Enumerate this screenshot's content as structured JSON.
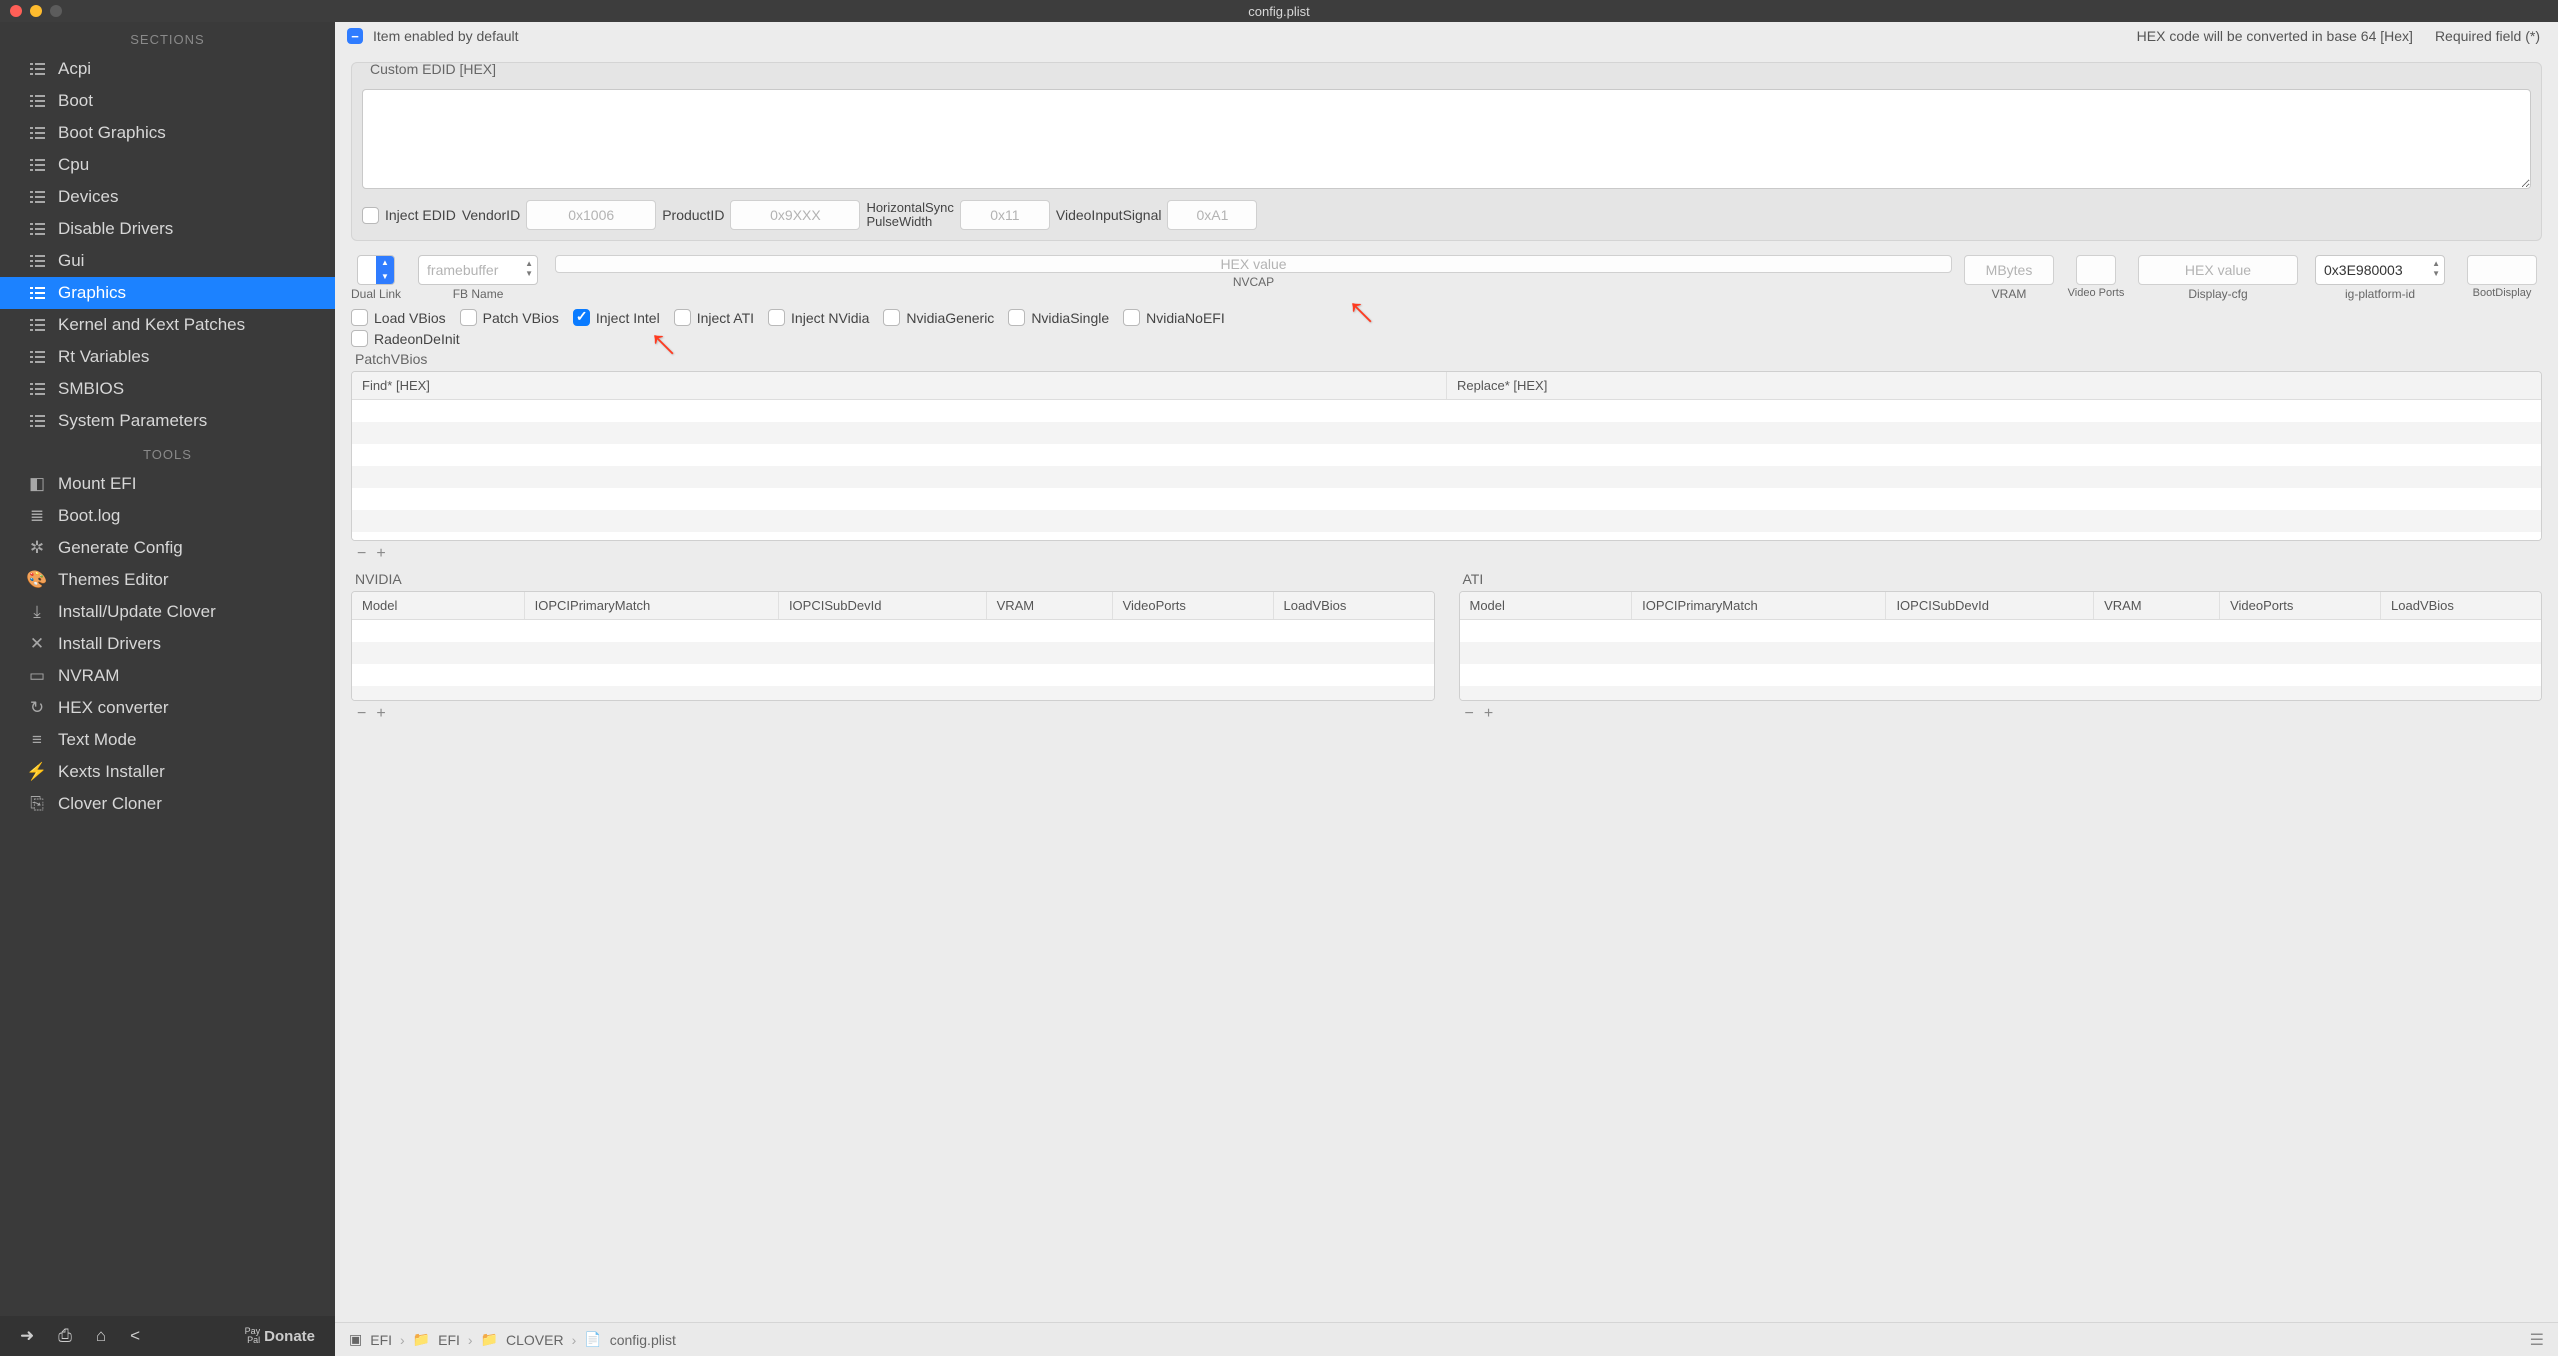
{
  "window": {
    "title": "config.plist"
  },
  "sidebar": {
    "sections_header": "SECTIONS",
    "tools_header": "TOOLS",
    "sections": [
      {
        "label": "Acpi"
      },
      {
        "label": "Boot"
      },
      {
        "label": "Boot Graphics"
      },
      {
        "label": "Cpu"
      },
      {
        "label": "Devices"
      },
      {
        "label": "Disable Drivers"
      },
      {
        "label": "Gui"
      },
      {
        "label": "Graphics"
      },
      {
        "label": "Kernel and Kext Patches"
      },
      {
        "label": "Rt Variables"
      },
      {
        "label": "SMBIOS"
      },
      {
        "label": "System Parameters"
      }
    ],
    "tools": [
      {
        "label": "Mount EFI",
        "glyph": "◧"
      },
      {
        "label": "Boot.log",
        "glyph": "≣"
      },
      {
        "label": "Generate Config",
        "glyph": "✲"
      },
      {
        "label": "Themes Editor",
        "glyph": "🎨"
      },
      {
        "label": "Install/Update Clover",
        "glyph": "⤓"
      },
      {
        "label": "Install Drivers",
        "glyph": "✕"
      },
      {
        "label": "NVRAM",
        "glyph": "▭"
      },
      {
        "label": "HEX converter",
        "glyph": "↻"
      },
      {
        "label": "Text Mode",
        "glyph": "≡"
      },
      {
        "label": "Kexts Installer",
        "glyph": "⚡"
      },
      {
        "label": "Clover Cloner",
        "glyph": "⎘"
      }
    ],
    "donate": "Donate"
  },
  "topbar": {
    "item_enabled": "Item enabled by default",
    "hex_note": "HEX code will be converted in base 64 [Hex]",
    "required": "Required field (*)"
  },
  "edid_group": {
    "legend": "Custom EDID [HEX]",
    "inject_edid": "Inject EDID",
    "vendor_lbl": "VendorID",
    "vendor_ph": "0x1006",
    "product_lbl": "ProductID",
    "product_ph": "0x9XXX",
    "hsync_lbl_a": "HorizontalSync",
    "hsync_lbl_b": "PulseWidth",
    "hsync_ph": "0x11",
    "video_lbl": "VideoInputSignal",
    "video_ph": "0xA1"
  },
  "fb_row": {
    "dual_link": "Dual Link",
    "fb_name": "FB Name",
    "fb_ph": "framebuffer",
    "nvcap": "NVCAP",
    "nvcap_ph": "HEX value",
    "vram": "VRAM",
    "vram_ph": "MBytes",
    "video_ports": "Video Ports",
    "display_cfg": "Display-cfg",
    "display_cfg_ph": "HEX value",
    "ig_platform": "ig-platform-id",
    "ig_value": "0x3E980003",
    "boot_display": "BootDisplay"
  },
  "checks": {
    "load_vbios": "Load VBios",
    "patch_vbios": "Patch VBios",
    "inject_intel": "Inject Intel",
    "inject_ati": "Inject ATI",
    "inject_nvidia": "Inject NVidia",
    "nvidia_generic": "NvidiaGeneric",
    "nvidia_single": "NvidiaSingle",
    "nvidia_noefi": "NvidiaNoEFI",
    "radeon_deinit": "RadeonDeInit"
  },
  "patchvbios": {
    "legend": "PatchVBios",
    "find": "Find* [HEX]",
    "replace": "Replace* [HEX]"
  },
  "nvidia_table": {
    "legend": "NVIDIA",
    "cols": [
      "Model",
      "IOPCIPrimaryMatch",
      "IOPCISubDevId",
      "VRAM",
      "VideoPorts",
      "LoadVBios"
    ]
  },
  "ati_table": {
    "legend": "ATI",
    "cols": [
      "Model",
      "IOPCIPrimaryMatch",
      "IOPCISubDevId",
      "VRAM",
      "VideoPorts",
      "LoadVBios"
    ]
  },
  "crumbs": [
    "EFI",
    "EFI",
    "CLOVER",
    "config.plist"
  ]
}
